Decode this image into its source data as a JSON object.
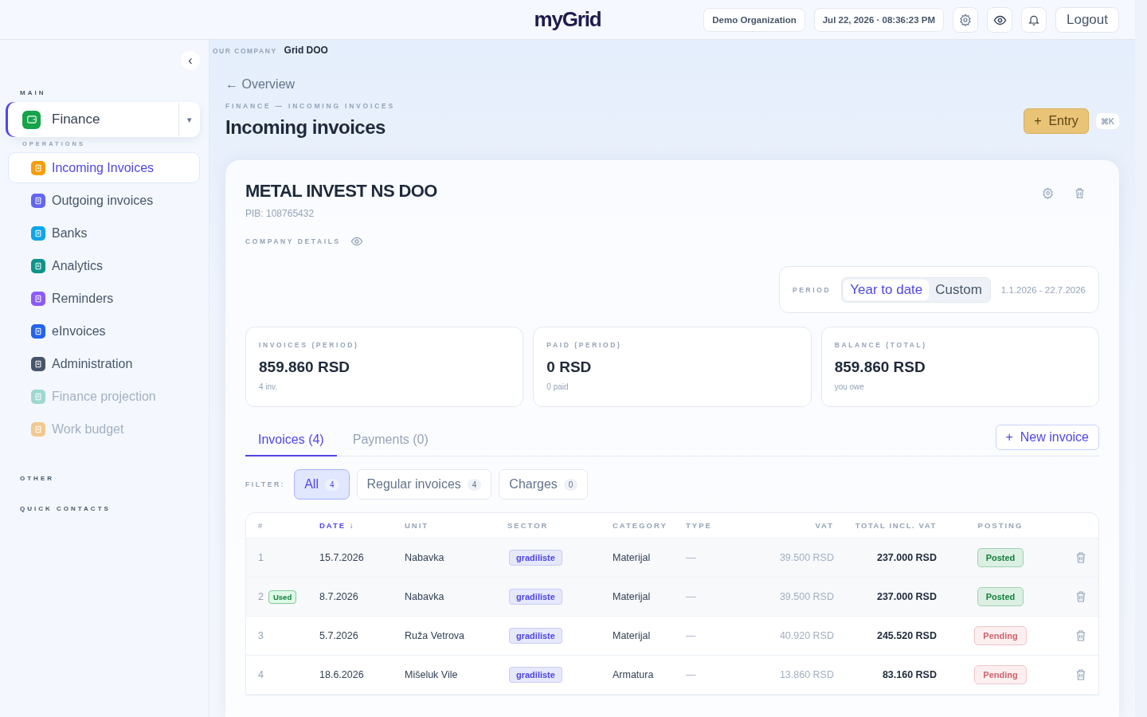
{
  "header": {
    "logo": "my**Grid**",
    "organization": "Demo Organization",
    "datetime": "Jul 22, 2026 · 08:36:23 PM",
    "logout": "Logout"
  },
  "sidebar": {
    "collapse": "‹",
    "main_label": "MAIN",
    "module": "Finance",
    "module_caret": "▾",
    "section_label": "OPERATIONS",
    "items": [
      {
        "label": "Incoming Invoices",
        "selected": true,
        "disabled": false,
        "color": "#f59e0b"
      },
      {
        "label": "Outgoing invoices",
        "selected": false,
        "disabled": false,
        "color": "#6366f1"
      },
      {
        "label": "Banks",
        "selected": false,
        "disabled": false,
        "color": "#0ea5e9"
      },
      {
        "label": "Analytics",
        "selected": false,
        "disabled": false,
        "color": "#0d9488"
      },
      {
        "label": "Reminders",
        "selected": false,
        "disabled": false,
        "color": "#8b5cf6"
      },
      {
        "label": "eInvoices",
        "selected": false,
        "disabled": false,
        "color": "#2563eb"
      },
      {
        "label": "Administration",
        "selected": false,
        "disabled": false,
        "color": "#475569"
      },
      {
        "label": "Finance projection",
        "selected": false,
        "disabled": true,
        "color": "#9fd8d0"
      },
      {
        "label": "Work budget",
        "selected": false,
        "disabled": true,
        "color": "#f2c98f"
      }
    ],
    "other_label": "OTHER",
    "contacts_label": "QUICK CONTACTS"
  },
  "company": {
    "label": "OUR COMPANY",
    "name": "Grid DOO"
  },
  "back_link": "← Overview",
  "breadcrumb": "FINANCE — INCOMING INVOICES",
  "title": "Incoming invoices",
  "entry_button": "+  Entry",
  "shortcut": "⌘K",
  "supplier": {
    "name": "METAL INVEST NS DOO",
    "pib": "PIB: 108765432",
    "details_label": "COMPANY DETAILS"
  },
  "period": {
    "label": "PERIOD",
    "options": [
      {
        "label": "Year to date",
        "selected": true
      },
      {
        "label": "Custom",
        "selected": false
      }
    ],
    "range": "1.1.2026 - 22.7.2026"
  },
  "stats": [
    {
      "label": "INVOICES (PERIOD)",
      "value": "859.860 RSD",
      "note": "4 inv."
    },
    {
      "label": "PAID (PERIOD)",
      "value": "0 RSD",
      "note": "0 paid"
    },
    {
      "label": "BALANCE (TOTAL)",
      "value": "859.860 RSD",
      "note": "you owe"
    }
  ],
  "tabs": [
    {
      "label": "Invoices (4)",
      "selected": true
    },
    {
      "label": "Payments (0)",
      "selected": false
    }
  ],
  "new_invoice": "+  New invoice",
  "filter": {
    "label": "FILTER:",
    "options": [
      {
        "label": "All",
        "count": "4",
        "selected": true
      },
      {
        "label": "Regular invoices",
        "count": "4",
        "selected": false
      },
      {
        "label": "Charges",
        "count": "0",
        "selected": false
      }
    ]
  },
  "table": {
    "columns": [
      {
        "label": "#",
        "sorted": false
      },
      {
        "label": "DATE ↓",
        "sorted": true
      },
      {
        "label": "UNIT",
        "sorted": false
      },
      {
        "label": "SECTOR",
        "sorted": false
      },
      {
        "label": "CATEGORY",
        "sorted": false
      },
      {
        "label": "TYPE",
        "sorted": false
      },
      {
        "label": "VAT",
        "sorted": false
      },
      {
        "label": "TOTAL INCL. VAT",
        "sorted": false
      },
      {
        "label": "POSTING",
        "sorted": false
      }
    ],
    "rows": [
      {
        "number": "1",
        "date": "15.7.2026",
        "unit": "Nabavka",
        "sector": "gradiliste",
        "category": "Materijal",
        "type": "—",
        "vat": "39.500 RSD",
        "total": "237.000 RSD",
        "posting": {
          "kind": "posted",
          "label": "Posted"
        }
      },
      {
        "number": "2",
        "badge": "Used",
        "date": "8.7.2026",
        "unit": "Nabavka",
        "sector": "gradiliste",
        "category": "Materijal",
        "type": "—",
        "vat": "39.500 RSD",
        "total": "237.000 RSD",
        "posting": {
          "kind": "posted",
          "label": "Posted"
        }
      },
      {
        "number": "3",
        "date": "5.7.2026",
        "unit": "Ruža Vetrova",
        "sector": "gradiliste",
        "category": "Materijal",
        "type": "—",
        "vat": "40.920 RSD",
        "total": "245.520 RSD",
        "posting": {
          "kind": "pending",
          "label": "Pending"
        }
      },
      {
        "number": "4",
        "date": "18.6.2026",
        "unit": "Mišeluk Vile",
        "sector": "gradiliste",
        "category": "Armatura",
        "type": "—",
        "vat": "13.860 RSD",
        "total": "83.160 RSD",
        "posting": {
          "kind": "pending",
          "label": "Pending"
        }
      }
    ]
  }
}
